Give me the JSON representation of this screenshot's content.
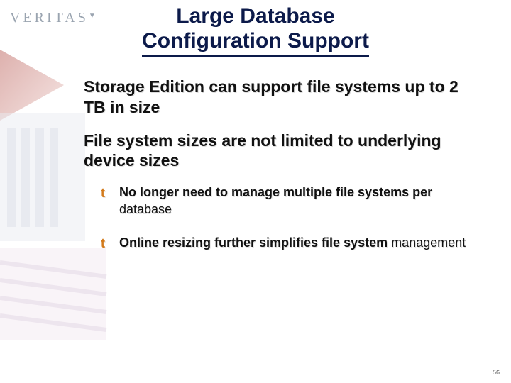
{
  "logo": {
    "text": "VERITAS"
  },
  "title": {
    "line1": "Large Database",
    "line2": "Configuration Support"
  },
  "points": {
    "p1": "Storage Edition can support file systems up to 2 TB in size",
    "p2": "File system sizes are not limited to underlying device sizes"
  },
  "subs": {
    "s1_lead": "No longer need to manage multiple file systems per",
    "s1_tail": " database",
    "s2_lead": "Online resizing further simplifies file system",
    "s2_tail": " management"
  },
  "bullet_glyph": "t",
  "page_number": "56"
}
